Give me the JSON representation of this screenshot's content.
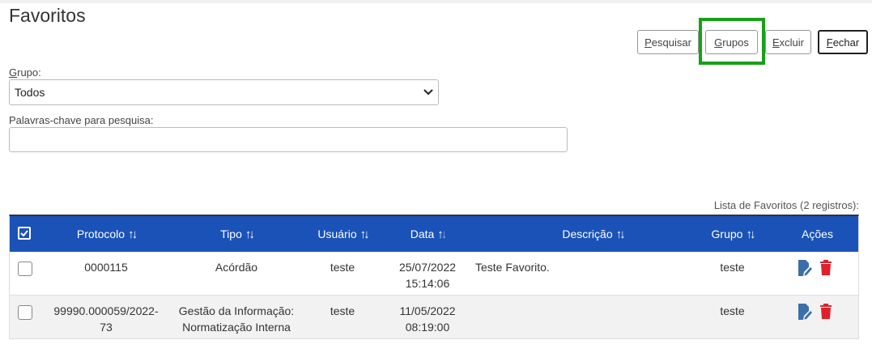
{
  "page": {
    "title": "Favoritos"
  },
  "toolbar": {
    "pesquisar": {
      "first": "P",
      "rest": "esquisar"
    },
    "grupos": {
      "first": "G",
      "rest": "rupos"
    },
    "excluir": {
      "first": "E",
      "rest": "xcluir"
    },
    "fechar": {
      "first": "F",
      "rest": "echar"
    }
  },
  "filters": {
    "grupo_label_first": "G",
    "grupo_label_rest": "rupo:",
    "grupo_value": "Todos",
    "keywords_label": "Palavras-chave para pesquisa:",
    "keywords_value": ""
  },
  "table": {
    "caption": "Lista de Favoritos (2 registros):",
    "headers": {
      "protocolo": "Protocolo",
      "tipo": "Tipo",
      "usuario": "Usuário",
      "data": "Data",
      "descricao": "Descrição",
      "grupo": "Grupo",
      "acoes": "Ações"
    },
    "rows": [
      {
        "protocolo": "0000115",
        "tipo": "Acórdão",
        "usuario": "teste",
        "data_date": "25/07/2022",
        "data_time": "15:14:06",
        "descricao": "Teste Favorito.",
        "grupo": "teste"
      },
      {
        "protocolo_line1": "99990.000059/2022-",
        "protocolo_line2": "73",
        "tipo_line1": "Gestão da Informação:",
        "tipo_line2": "Normatização Interna",
        "usuario": "teste",
        "data_date": "11/05/2022",
        "data_time": "08:19:00",
        "descricao": "",
        "grupo": "teste"
      }
    ]
  },
  "colors": {
    "header_bg": "#1a52b8",
    "highlight": "#18a018",
    "edit_icon": "#3a6fa8",
    "delete_icon": "#e0202a"
  },
  "icons": [
    "checkbox-checked-icon",
    "sort-icon",
    "edit-icon",
    "trash-icon",
    "chevron-down-icon"
  ]
}
